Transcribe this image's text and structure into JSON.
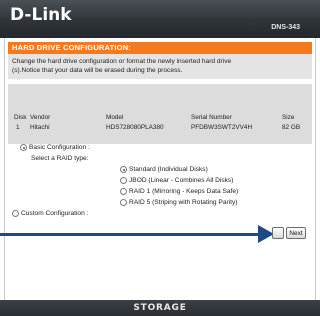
{
  "header": {
    "logo_text": "D-Link",
    "model_text": "DNS-343"
  },
  "section": {
    "title": "HARD DRIVE CONFIGURATION:",
    "description_line1": "Change the hard drive configuration or format the newly inserted hard drive",
    "description_line2": "(s).Notice that your data will be erased during the process."
  },
  "disk_table": {
    "columns": [
      "Disk",
      "Vendor",
      "Model",
      "Serial Number",
      "Size"
    ],
    "rows": [
      [
        "1",
        "Hitachi",
        "HDS728080PLA380",
        "PFDBW3SWT2VV4H",
        "82 GB"
      ]
    ]
  },
  "config": {
    "basic_label": "Basic Configuration :",
    "basic_selected": true,
    "select_raid_label": "Select a RAID type:",
    "raid_options": [
      {
        "label": "Standard (Individual Disks)",
        "selected": true
      },
      {
        "label": "JBOD (Linear - Combines All Disks)",
        "selected": false
      },
      {
        "label": "RAID 1 (Mirroring - Keeps Data Safe)",
        "selected": false
      },
      {
        "label": "RAID 5 (Striping with Rotating Parity)",
        "selected": false
      }
    ],
    "custom_label": "Custom Configuration :",
    "custom_selected": false
  },
  "buttons": {
    "next_label": "Next"
  },
  "footer": {
    "text": "STORAGE"
  },
  "colors": {
    "header_bg": "#2f3439",
    "section_bar": "#f47a20",
    "desc_bg": "#e4e4e4",
    "table_bg": "#dcdcdc",
    "arrow": "#1b4a86"
  }
}
